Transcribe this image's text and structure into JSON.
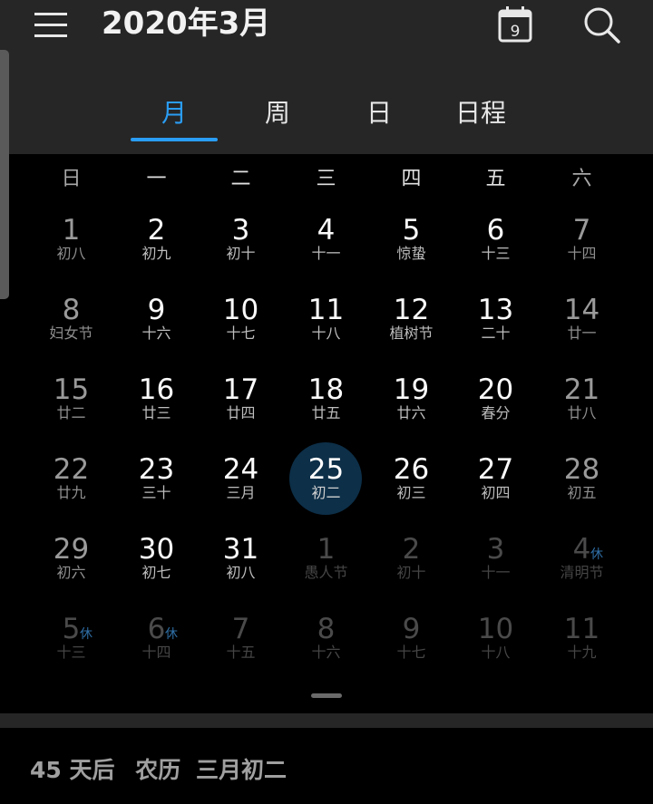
{
  "header": {
    "title": "2020年3月",
    "today_icon_day": "9",
    "icons": {
      "menu": "hamburger-icon",
      "today": "calendar-today-icon",
      "search": "search-icon"
    }
  },
  "tabs": [
    {
      "label": "月",
      "active": true
    },
    {
      "label": "周",
      "active": false
    },
    {
      "label": "日",
      "active": false
    },
    {
      "label": "日程",
      "active": false
    }
  ],
  "weekdays": [
    "日",
    "一",
    "二",
    "三",
    "四",
    "五",
    "六"
  ],
  "weeks": [
    [
      {
        "day": "1",
        "lunar": "初八",
        "type": "weekend"
      },
      {
        "day": "2",
        "lunar": "初九",
        "type": "normal"
      },
      {
        "day": "3",
        "lunar": "初十",
        "type": "normal"
      },
      {
        "day": "4",
        "lunar": "十一",
        "type": "normal"
      },
      {
        "day": "5",
        "lunar": "惊蛰",
        "type": "normal"
      },
      {
        "day": "6",
        "lunar": "十三",
        "type": "normal"
      },
      {
        "day": "7",
        "lunar": "十四",
        "type": "weekend"
      }
    ],
    [
      {
        "day": "8",
        "lunar": "妇女节",
        "type": "weekend"
      },
      {
        "day": "9",
        "lunar": "十六",
        "type": "normal"
      },
      {
        "day": "10",
        "lunar": "十七",
        "type": "normal"
      },
      {
        "day": "11",
        "lunar": "十八",
        "type": "normal"
      },
      {
        "day": "12",
        "lunar": "植树节",
        "type": "normal"
      },
      {
        "day": "13",
        "lunar": "二十",
        "type": "normal"
      },
      {
        "day": "14",
        "lunar": "廿一",
        "type": "weekend"
      }
    ],
    [
      {
        "day": "15",
        "lunar": "廿二",
        "type": "weekend"
      },
      {
        "day": "16",
        "lunar": "廿三",
        "type": "normal"
      },
      {
        "day": "17",
        "lunar": "廿四",
        "type": "normal"
      },
      {
        "day": "18",
        "lunar": "廿五",
        "type": "normal"
      },
      {
        "day": "19",
        "lunar": "廿六",
        "type": "normal"
      },
      {
        "day": "20",
        "lunar": "春分",
        "type": "normal"
      },
      {
        "day": "21",
        "lunar": "廿八",
        "type": "weekend"
      }
    ],
    [
      {
        "day": "22",
        "lunar": "廿九",
        "type": "weekend"
      },
      {
        "day": "23",
        "lunar": "三十",
        "type": "normal"
      },
      {
        "day": "24",
        "lunar": "三月",
        "type": "normal"
      },
      {
        "day": "25",
        "lunar": "初二",
        "type": "today"
      },
      {
        "day": "26",
        "lunar": "初三",
        "type": "normal"
      },
      {
        "day": "27",
        "lunar": "初四",
        "type": "normal"
      },
      {
        "day": "28",
        "lunar": "初五",
        "type": "weekend"
      }
    ],
    [
      {
        "day": "29",
        "lunar": "初六",
        "type": "weekend"
      },
      {
        "day": "30",
        "lunar": "初七",
        "type": "normal"
      },
      {
        "day": "31",
        "lunar": "初八",
        "type": "normal"
      },
      {
        "day": "1",
        "lunar": "愚人节",
        "type": "other"
      },
      {
        "day": "2",
        "lunar": "初十",
        "type": "other"
      },
      {
        "day": "3",
        "lunar": "十一",
        "type": "other"
      },
      {
        "day": "4",
        "lunar": "清明节",
        "type": "other",
        "badge": "休"
      }
    ],
    [
      {
        "day": "5",
        "lunar": "十三",
        "type": "other",
        "badge": "休"
      },
      {
        "day": "6",
        "lunar": "十四",
        "type": "other",
        "badge": "休"
      },
      {
        "day": "7",
        "lunar": "十五",
        "type": "other"
      },
      {
        "day": "8",
        "lunar": "十六",
        "type": "other"
      },
      {
        "day": "9",
        "lunar": "十七",
        "type": "other"
      },
      {
        "day": "10",
        "lunar": "十八",
        "type": "other"
      },
      {
        "day": "11",
        "lunar": "十九",
        "type": "other"
      }
    ]
  ],
  "footer": {
    "days_after": "45 天后",
    "lunar_prefix": "农历",
    "lunar_date": "三月初二"
  },
  "colors": {
    "accent": "#2a9df4",
    "today_circle": "#0d2f48",
    "rest_badge": "#2f6fa6"
  }
}
